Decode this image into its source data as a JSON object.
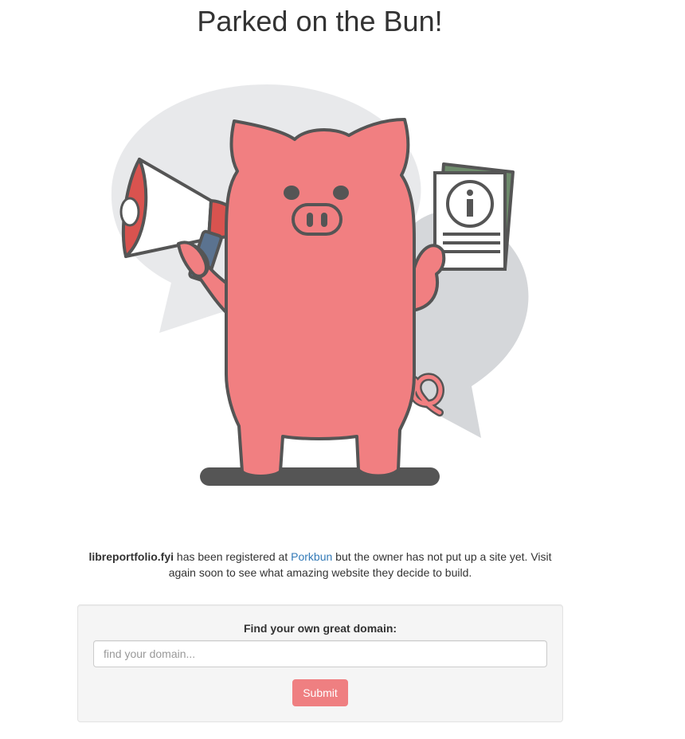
{
  "page": {
    "title": "Parked on the Bun!"
  },
  "notice": {
    "domain": "libreportfolio.fyi",
    "text_before_link": " has been registered at ",
    "link_text": "Porkbun",
    "text_after_link": " but the owner has not put up a site yet. Visit again soon to see what amazing website they decide to build."
  },
  "search": {
    "label": "Find your own great domain:",
    "value": "",
    "placeholder": "find your domain...",
    "submit_label": "Submit"
  },
  "colors": {
    "pig": "#f17f81",
    "outline": "#555555",
    "bubble_light": "#e8e9eb",
    "bubble_dark": "#d5d7da",
    "megaphone_red": "#d9534f",
    "handle_blue": "#5b7390",
    "paper_green": "#6e8b6c",
    "link": "#337ab7",
    "submit_button": "#ef7f81"
  },
  "icons": [
    "megaphone-icon",
    "info-icon"
  ]
}
